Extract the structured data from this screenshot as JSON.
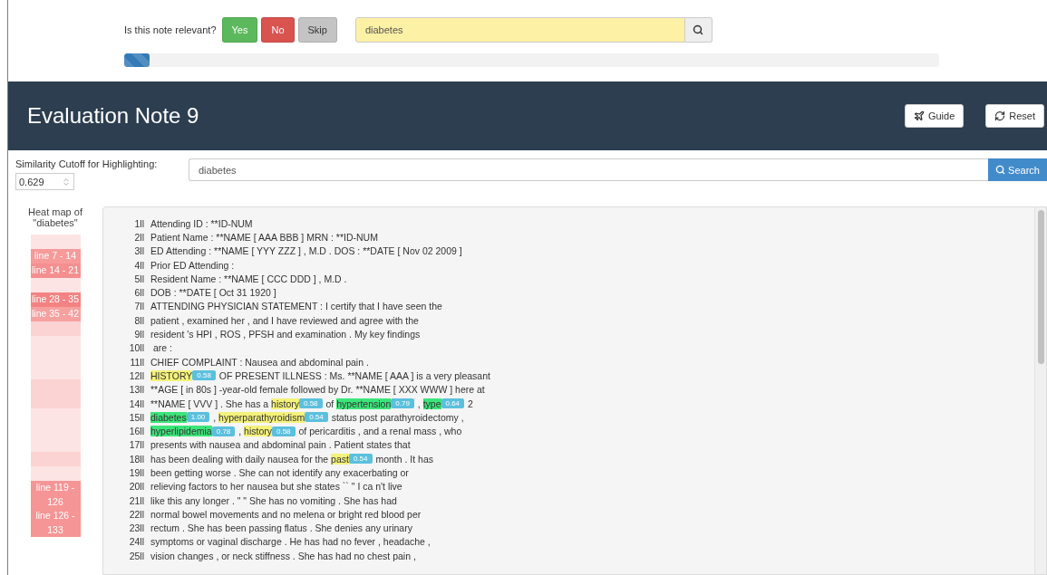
{
  "relevance": {
    "question": "Is this note relevant?",
    "buttons": [
      {
        "label": "Yes",
        "kind": "yes"
      },
      {
        "label": "No",
        "kind": "no"
      },
      {
        "label": "Skip",
        "kind": "skip"
      }
    ]
  },
  "top_search": {
    "value": "diabetes"
  },
  "progress": {
    "level": 0.031
  },
  "header": {
    "title": "Evaluation Note 9",
    "buttons": [
      {
        "label": "Guide",
        "kind": "guide"
      },
      {
        "label": "Reset",
        "kind": "reset"
      }
    ]
  },
  "cutoff": {
    "label": "Similarity Cutoff for Highlighting:",
    "value": "0.629"
  },
  "search": {
    "value": "diabetes",
    "button": "Search"
  },
  "heatmap": {
    "title": "Heat map of \"diabetes\"",
    "rows": [
      {
        "color": "#fde4e4"
      },
      {
        "label": "line 7 - 14",
        "color": "#f79a9a"
      },
      {
        "label": "line 14 - 21",
        "color": "#f58f8f"
      },
      {
        "color": "#fde4e4"
      },
      {
        "label": "line 28 - 35",
        "color": "#f38383"
      },
      {
        "label": "line 35 - 42",
        "color": "#f7a0a0"
      },
      {
        "color": "#fbd3d3"
      },
      {
        "color": "#fde4e4"
      },
      {
        "color": "#fde4e4"
      },
      {
        "color": "#fde4e4"
      },
      {
        "color": "#fbd3d3"
      },
      {
        "color": "#fbd3d3"
      },
      {
        "color": "#fde4e4"
      },
      {
        "color": "#fde4e4"
      },
      {
        "color": "#fde4e4"
      },
      {
        "color": "#fbd3d3"
      },
      {
        "color": "#fde4e4"
      },
      {
        "label": "line 119 - 126",
        "color": "#f59595"
      },
      {
        "label": "line 126 - 133",
        "color": "#f59595"
      }
    ]
  },
  "note": {
    "lines": [
      {
        "number": "1ll",
        "segments": [
          {
            "text": "Attending ID : **ID-NUM"
          }
        ]
      },
      {
        "number": "2ll",
        "segments": [
          {
            "text": "Patient Name : **NAME [ AAA BBB ] MRN : **ID-NUM"
          }
        ]
      },
      {
        "number": "3ll",
        "segments": [
          {
            "text": "ED Attending : **NAME [ YYY ZZZ ] , M.D . DOS : **DATE [ Nov 02 2009 ]"
          }
        ]
      },
      {
        "number": "4ll",
        "segments": [
          {
            "text": "Prior ED Attending :"
          }
        ]
      },
      {
        "number": "5ll",
        "segments": [
          {
            "text": "Resident Name : **NAME [ CCC DDD ] , M.D ."
          }
        ]
      },
      {
        "number": "6ll",
        "segments": [
          {
            "text": "DOB : **DATE [ Oct 31 1920 ]"
          }
        ]
      },
      {
        "number": "7ll",
        "segments": [
          {
            "text": "ATTENDING PHYSICIAN STATEMENT : I certify that I have seen the"
          }
        ]
      },
      {
        "number": "8ll",
        "segments": [
          {
            "text": "patient , examined her , and I have reviewed and agree with the"
          }
        ]
      },
      {
        "number": "9ll",
        "segments": [
          {
            "text": "resident 's HPI , ROS , PFSH and examination . My key findings"
          }
        ]
      },
      {
        "number": "10ll",
        "segments": [
          {
            "text": " are :"
          }
        ]
      },
      {
        "number": "11ll",
        "segments": [
          {
            "text": "CHIEF COMPLAINT : Nausea and abdominal pain ."
          }
        ]
      },
      {
        "number": "12ll",
        "segments": [
          {
            "term": "HISTORY",
            "score": "0.58",
            "color": "#f4f27a"
          },
          {
            "text": " OF PRESENT ILLNESS : Ms. **NAME [ AAA ] is a very pleasant"
          }
        ]
      },
      {
        "number": "13ll",
        "segments": [
          {
            "text": "**AGE [ in 80s ] -year-old female followed by Dr. **NAME [ XXX WWW ] here at"
          }
        ]
      },
      {
        "number": "14ll",
        "segments": [
          {
            "text": "**NAME [ VVV ] . She has a "
          },
          {
            "term": "history",
            "score": "0.58",
            "color": "#f4f27a"
          },
          {
            "text": " of "
          },
          {
            "term": "hypertension",
            "score": "0.79",
            "color": "#3be57a"
          },
          {
            "text": " , "
          },
          {
            "term": "type",
            "score": "0.64",
            "color": "#3be57a"
          },
          {
            "text": " 2"
          }
        ]
      },
      {
        "number": "15ll",
        "segments": [
          {
            "term": "diabetes",
            "score": "1.00",
            "color": "#3be57a"
          },
          {
            "text": " , "
          },
          {
            "term": "hyperparathyroidism",
            "score": "0.54",
            "color": "#f4f27a"
          },
          {
            "text": " status post parathyroidectomy ,"
          }
        ]
      },
      {
        "number": "16ll",
        "segments": [
          {
            "term": "hyperlipidemia",
            "score": "0.78",
            "color": "#3be57a"
          },
          {
            "text": " , "
          },
          {
            "term": "history",
            "score": "0.58",
            "color": "#f4f27a"
          },
          {
            "text": " of pericarditis , and a renal mass , who"
          }
        ]
      },
      {
        "number": "17ll",
        "segments": [
          {
            "text": "presents with nausea and abdominal pain . Patient states that"
          }
        ]
      },
      {
        "number": "18ll",
        "segments": [
          {
            "text": "has been dealing with daily nausea for the "
          },
          {
            "term": "past",
            "score": "0.54",
            "color": "#f4f27a"
          },
          {
            "text": " month . It has"
          }
        ]
      },
      {
        "number": "19ll",
        "segments": [
          {
            "text": "been getting worse . She can not identify any exacerbating or"
          }
        ]
      },
      {
        "number": "20ll",
        "segments": [
          {
            "text": "relieving factors to her nausea but she states `` \" I ca n't live"
          }
        ]
      },
      {
        "number": "21ll",
        "segments": [
          {
            "text": "like this any longer . \" \" She has no vomiting . She has had"
          }
        ]
      },
      {
        "number": "22ll",
        "segments": [
          {
            "text": "normal bowel movements and no melena or bright red blood per"
          }
        ]
      },
      {
        "number": "23ll",
        "segments": [
          {
            "text": "rectum . She has been passing flatus . She denies any urinary"
          }
        ]
      },
      {
        "number": "24ll",
        "segments": [
          {
            "text": "symptoms or vaginal discharge . He has had no fever , headache ,"
          }
        ]
      },
      {
        "number": "25ll",
        "segments": [
          {
            "text": "vision changes , or neck stiffness . She has had no chest pain ,"
          }
        ]
      }
    ]
  }
}
